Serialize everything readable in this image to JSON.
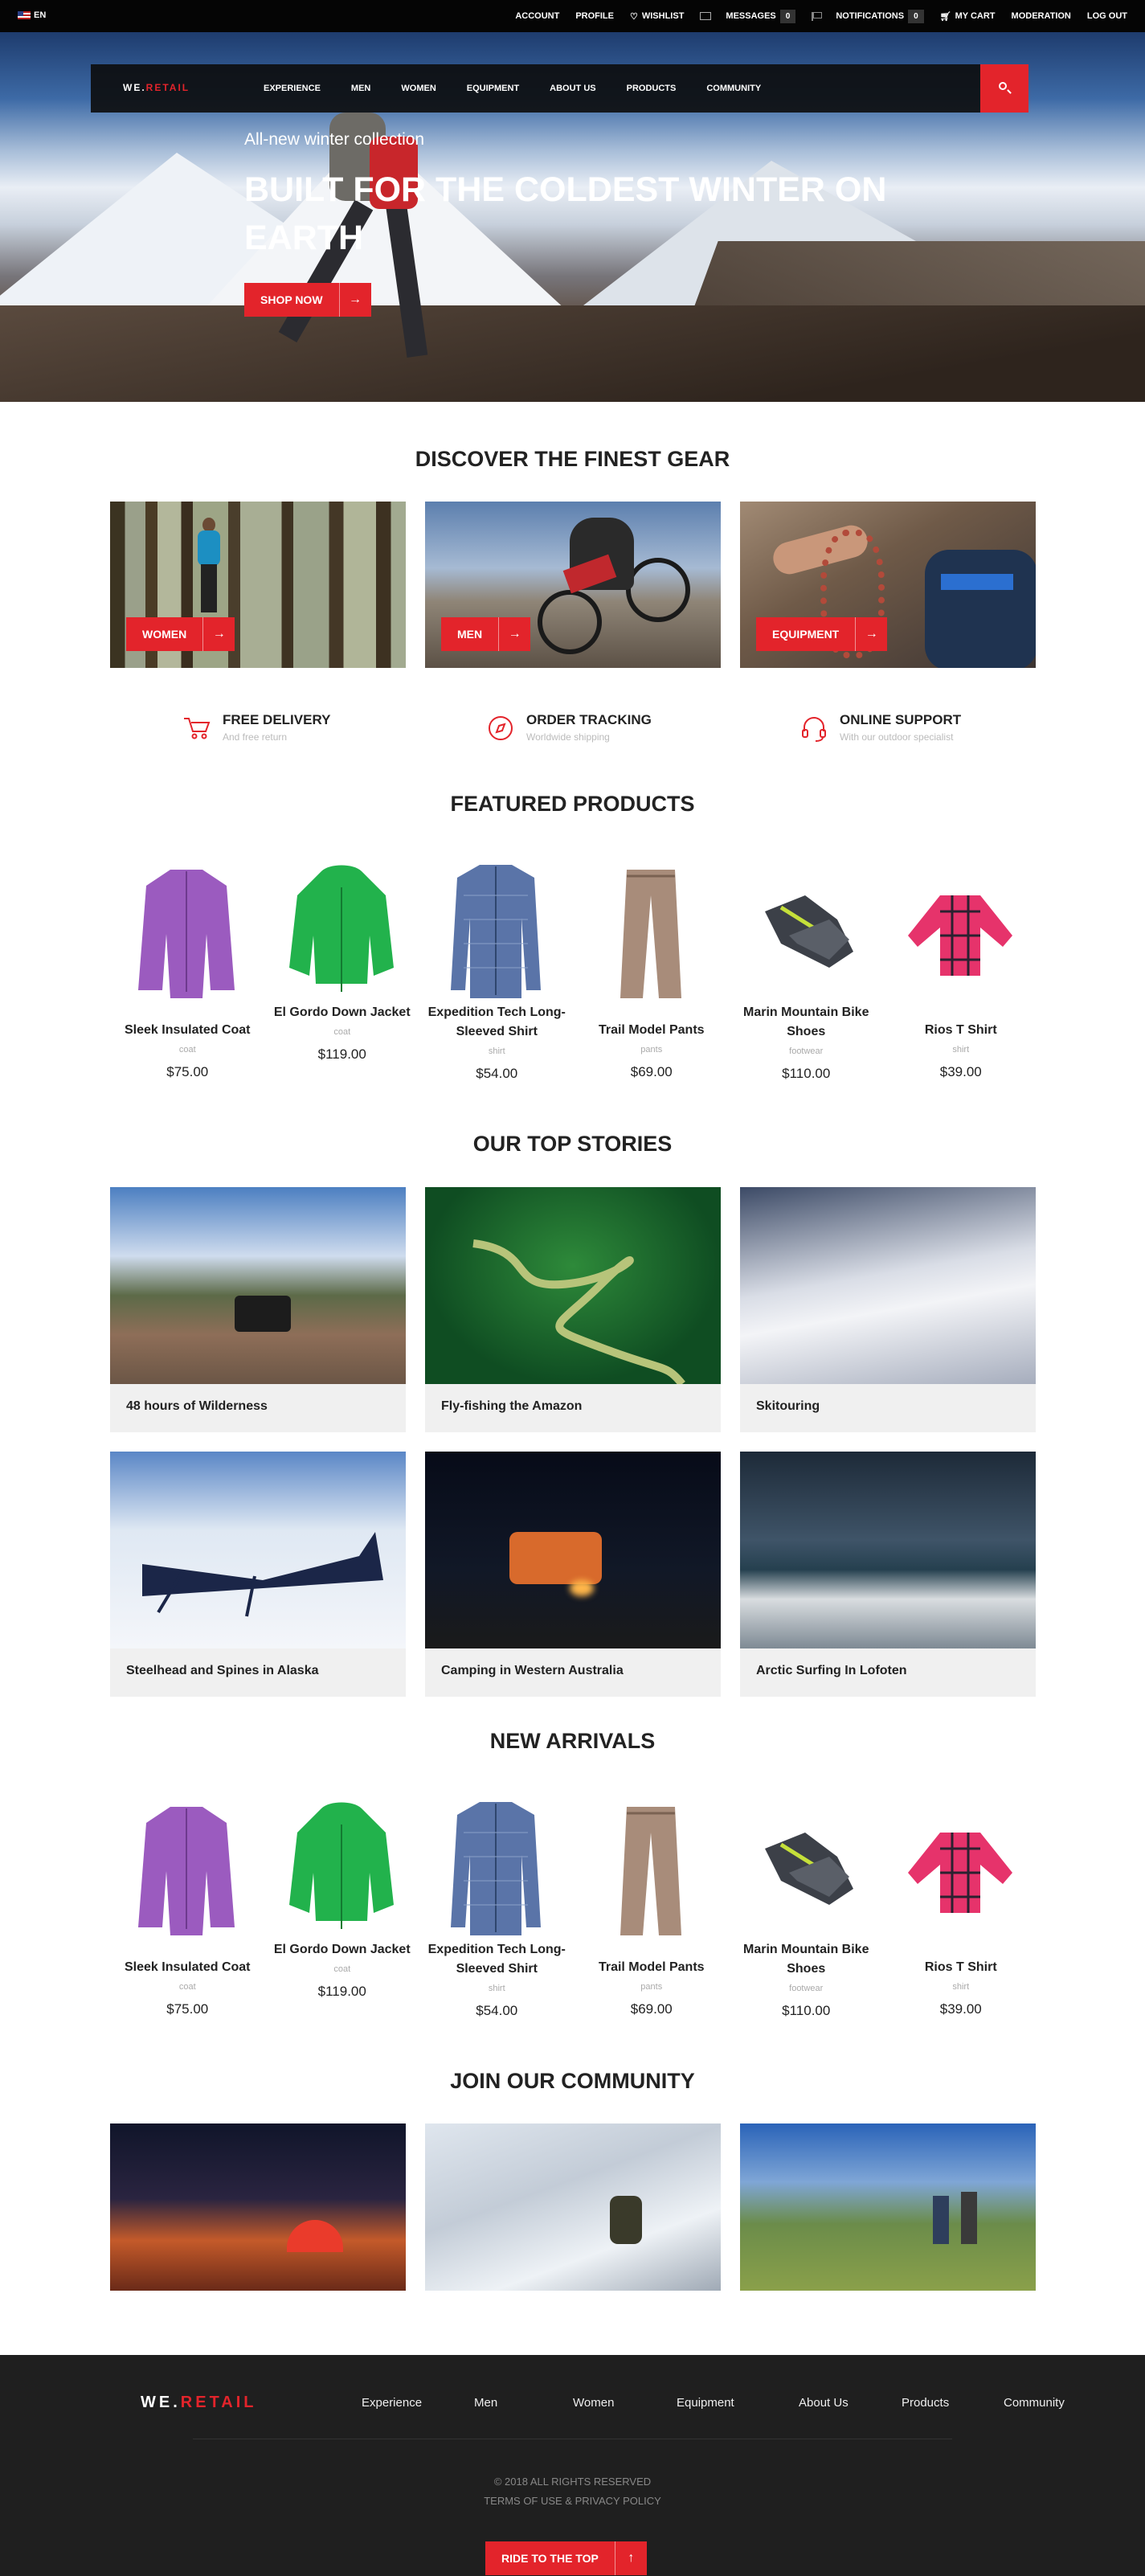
{
  "topbar": {
    "lang": "EN",
    "account": "ACCOUNT",
    "profile": "PROFILE",
    "wishlist": "WISHLIST",
    "messages": "MESSAGES",
    "messages_count": "0",
    "notifications": "NOTIFICATIONS",
    "notifications_count": "0",
    "cart": "MY CART",
    "moderation": "MODERATION",
    "logout": "LOG OUT"
  },
  "nav": {
    "logo_a": "WE.",
    "logo_b": "RETAIL",
    "items": [
      "EXPERIENCE",
      "MEN",
      "WOMEN",
      "EQUIPMENT",
      "ABOUT US",
      "PRODUCTS",
      "COMMUNITY"
    ]
  },
  "hero": {
    "kicker": "All-new winter collection",
    "headline": "BUILT FOR THE COLDEST WINTER ON EARTH",
    "cta": "SHOP NOW",
    "cta_icon": "arrow-right-icon"
  },
  "discover": {
    "title": "DISCOVER THE FINEST GEAR",
    "categories": [
      "WOMEN",
      "MEN",
      "EQUIPMENT"
    ]
  },
  "features": [
    {
      "title": "FREE DELIVERY",
      "sub": "And free return",
      "icon": "cart-icon"
    },
    {
      "title": "ORDER TRACKING",
      "sub": "Worldwide shipping",
      "icon": "compass-icon"
    },
    {
      "title": "ONLINE SUPPORT",
      "sub": "With our outdoor specialist",
      "icon": "headset-icon"
    }
  ],
  "featured": {
    "title": "FEATURED PRODUCTS",
    "products": [
      {
        "name": "Sleek Insulated Coat",
        "type": "coat",
        "price": "$75.00"
      },
      {
        "name": "El Gordo Down Jacket",
        "type": "coat",
        "price": "$119.00"
      },
      {
        "name": "Expedition Tech Long-Sleeved Shirt",
        "type": "shirt",
        "price": "$54.00"
      },
      {
        "name": "Trail Model Pants",
        "type": "pants",
        "price": "$69.00"
      },
      {
        "name": "Marin Mountain Bike Shoes",
        "type": "footwear",
        "price": "$110.00"
      },
      {
        "name": "Rios T Shirt",
        "type": "shirt",
        "price": "$39.00"
      }
    ]
  },
  "stories": {
    "title": "OUR TOP STORIES",
    "items": [
      "48 hours of Wilderness",
      "Fly-fishing the Amazon",
      "Skitouring",
      "Steelhead and Spines in Alaska",
      "Camping in Western Australia",
      "Arctic Surfing In Lofoten"
    ]
  },
  "arrivals": {
    "title": "NEW ARRIVALS",
    "products": [
      {
        "name": "Sleek Insulated Coat",
        "type": "coat",
        "price": "$75.00"
      },
      {
        "name": "El Gordo Down Jacket",
        "type": "coat",
        "price": "$119.00"
      },
      {
        "name": "Expedition Tech Long-Sleeved Shirt",
        "type": "shirt",
        "price": "$54.00"
      },
      {
        "name": "Trail Model Pants",
        "type": "pants",
        "price": "$69.00"
      },
      {
        "name": "Marin Mountain Bike Shoes",
        "type": "footwear",
        "price": "$110.00"
      },
      {
        "name": "Rios T Shirt",
        "type": "shirt",
        "price": "$39.00"
      }
    ]
  },
  "community": {
    "title": "JOIN OUR COMMUNITY"
  },
  "footer": {
    "logo_a": "WE.",
    "logo_b": "RETAIL",
    "links": [
      "Experience",
      "Men",
      "Women",
      "Equipment",
      "About Us",
      "Products",
      "Community"
    ],
    "copyright": "© 2018 ALL RIGHTS RESERVED",
    "terms": "TERMS OF USE & PRIVACY POLICY",
    "top_button": "RIDE TO THE TOP",
    "top_icon": "arrow-up-icon"
  },
  "colors": {
    "accent": "#e3242b",
    "dark": "#050505",
    "footer": "#1f1f1f"
  }
}
